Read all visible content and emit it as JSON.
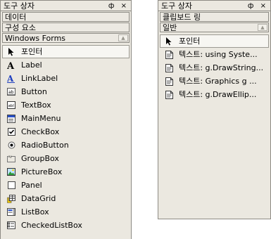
{
  "left": {
    "title": "도구 상자",
    "pin_glyph": "ф",
    "close_glyph": "×",
    "tabs": [
      "데이터",
      "구성 요소",
      "Windows Forms"
    ],
    "scroll_glyph": "▲",
    "items": [
      {
        "label": "포인터",
        "icon": "pointer-icon"
      },
      {
        "label": "Label",
        "icon": "label-icon"
      },
      {
        "label": "LinkLabel",
        "icon": "linklabel-icon"
      },
      {
        "label": "Button",
        "icon": "button-icon"
      },
      {
        "label": "TextBox",
        "icon": "textbox-icon"
      },
      {
        "label": "MainMenu",
        "icon": "mainmenu-icon"
      },
      {
        "label": "CheckBox",
        "icon": "checkbox-icon"
      },
      {
        "label": "RadioButton",
        "icon": "radiobutton-icon"
      },
      {
        "label": "GroupBox",
        "icon": "groupbox-icon"
      },
      {
        "label": "PictureBox",
        "icon": "picturebox-icon"
      },
      {
        "label": "Panel",
        "icon": "panel-icon"
      },
      {
        "label": "DataGrid",
        "icon": "datagrid-icon"
      },
      {
        "label": "ListBox",
        "icon": "listbox-icon"
      },
      {
        "label": "CheckedListBox",
        "icon": "checkedlistbox-icon"
      }
    ]
  },
  "right": {
    "title": "도구 상자",
    "pin_glyph": "ф",
    "close_glyph": "×",
    "tabs": [
      "클립보드 링",
      "일반"
    ],
    "scroll_glyph": "▲",
    "items": [
      {
        "label": "포인터",
        "icon": "pointer-icon"
      },
      {
        "label": "텍스트: using Syste...",
        "icon": "text-snippet-icon"
      },
      {
        "label": "텍스트: g.DrawString...",
        "icon": "text-snippet-icon"
      },
      {
        "label": "텍스트: Graphics g ...",
        "icon": "text-snippet-icon"
      },
      {
        "label": "텍스트: g.DrawEllip...",
        "icon": "text-snippet-icon"
      }
    ]
  }
}
